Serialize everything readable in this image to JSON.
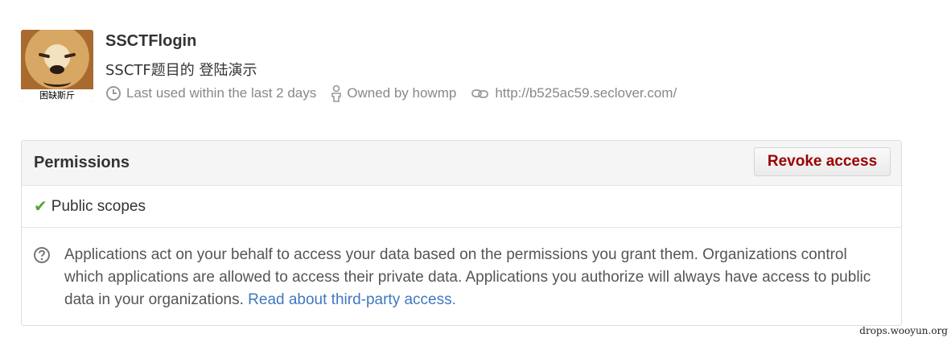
{
  "app": {
    "name": "SSCTFlogin",
    "description": "SSCTF题目的 登陆演示",
    "avatar_caption": "困缺斯斤"
  },
  "meta": {
    "last_used": "Last used within the last 2 days",
    "owner": "Owned by howmp",
    "url": "http://b525ac59.seclover.com/"
  },
  "permissions": {
    "title": "Permissions",
    "revoke_label": "Revoke access",
    "scope": "Public scopes",
    "help_text": "Applications act on your behalf to access your data based on the permissions you grant them. Organizations control which applications are allowed to access their private data. Applications you authorize will always have access to public data in your organizations.",
    "help_link": "Read about third-party access."
  },
  "watermark": "drops.wooyun.org",
  "colors": {
    "revoke": "#990000",
    "check": "#55a532",
    "link": "#4078c0",
    "meta_text": "#888888"
  }
}
